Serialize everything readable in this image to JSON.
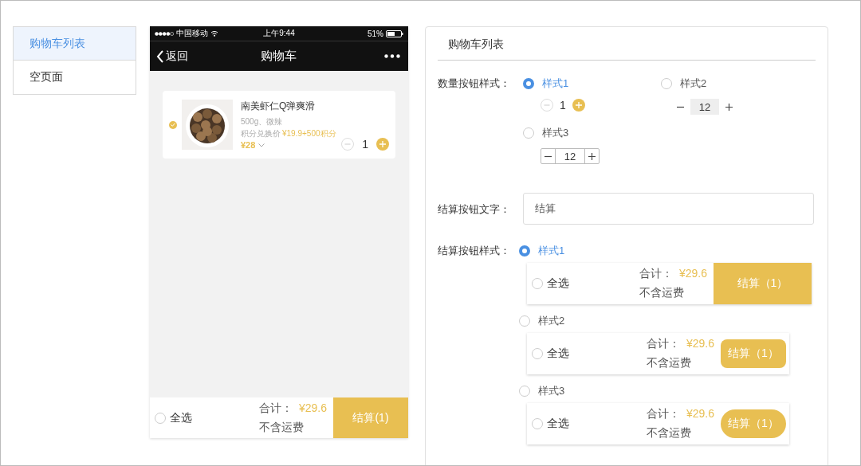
{
  "sidebar": {
    "items": [
      {
        "label": "购物车列表",
        "selected": true
      },
      {
        "label": "空页面",
        "selected": false
      }
    ]
  },
  "phone": {
    "status_bar": {
      "carrier": "中国移动",
      "time": "上午9:44",
      "battery": "51%"
    },
    "nav": {
      "back": "返回",
      "title": "购物车"
    },
    "cart_item": {
      "checked": true,
      "name": "南美虾仁Q弹爽滑",
      "spec": "500g、微辣",
      "points_label": "积分兑换价",
      "points_price": "¥19.9+500积分",
      "price": "¥28",
      "quantity": "1"
    },
    "footer": {
      "select_all": "全选",
      "checked": false,
      "total_label": "合计：",
      "total": "¥29.6",
      "shipping": "不含运费",
      "checkout": "结算(1)"
    }
  },
  "settings": {
    "title": "购物车列表",
    "quantity_style": {
      "label": "数量按钮样式：",
      "options": [
        {
          "label": "样式1",
          "selected": true,
          "kind": "circle",
          "value": "1"
        },
        {
          "label": "样式2",
          "selected": false,
          "kind": "plain",
          "value": "12"
        },
        {
          "label": "样式3",
          "selected": false,
          "kind": "boxed",
          "value": "12"
        }
      ]
    },
    "checkout_text": {
      "label": "结算按钮文字：",
      "value": "结算"
    },
    "checkout_style": {
      "label": "结算按钮样式：",
      "options": [
        {
          "label": "样式1",
          "selected": true,
          "kind": "square",
          "select_all": "全选",
          "checked": false,
          "total_label": "合计：",
          "total": "¥29.6",
          "shipping": "不含运费",
          "button": "结算（1）"
        },
        {
          "label": "样式2",
          "selected": false,
          "kind": "rounded",
          "select_all": "全选",
          "checked": false,
          "total_label": "合计：",
          "total": "¥29.6",
          "shipping": "不含运费",
          "button": "结算（1）"
        },
        {
          "label": "样式3",
          "selected": false,
          "kind": "pill",
          "select_all": "全选",
          "checked": false,
          "total_label": "合计：",
          "total": "¥29.6",
          "shipping": "不含运费",
          "button": "结算（1）"
        }
      ]
    }
  }
}
